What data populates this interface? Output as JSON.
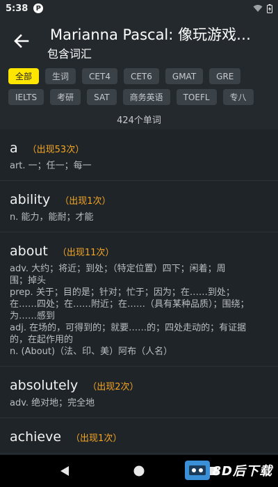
{
  "status": {
    "time": "5:38"
  },
  "header": {
    "title": "Marianna Pascal: 像玩游戏…",
    "subtitle": "包含词汇"
  },
  "filters": {
    "row1": [
      "全部",
      "生词",
      "CET4",
      "CET6",
      "GMAT",
      "GRE"
    ],
    "row2": [
      "IELTS",
      "考研",
      "SAT",
      "商务英语",
      "TOEFL",
      "专八"
    ],
    "active": "全部",
    "count_label": "424个单词"
  },
  "words": [
    {
      "word": "a",
      "freq": "（出现53次）",
      "def": "art. 一；任一；每一"
    },
    {
      "word": "ability",
      "freq": "（出现1次）",
      "def": "n. 能力，能耐；才能"
    },
    {
      "word": "about",
      "freq": "（出现11次）",
      "def": "adv. 大约；将近；到处；（特定位置）四下；闲着；周\n围；掉头\nprep. 关于；目的是；针对；忙于；因为；在……到处；\n在……四处；在……附近；在……（具有某种品质）；围绕；\n为……感到\nadj. 在场的，可得到的；就要……的；四处走动的；有证据\n的，在起作用的\nn. (About)（法、印、美）阿布（人名）"
    },
    {
      "word": "absolutely",
      "freq": "（出现2次）",
      "def": "adv. 绝对地；完全地"
    },
    {
      "word": "achieve",
      "freq": "（出现1次）",
      "def": ""
    }
  ],
  "colors": {
    "accent": "#ffe600",
    "freq": "#f5a623",
    "background": "#1f2428",
    "header": "#24292e"
  },
  "watermark": {
    "text": "8D后下载"
  }
}
